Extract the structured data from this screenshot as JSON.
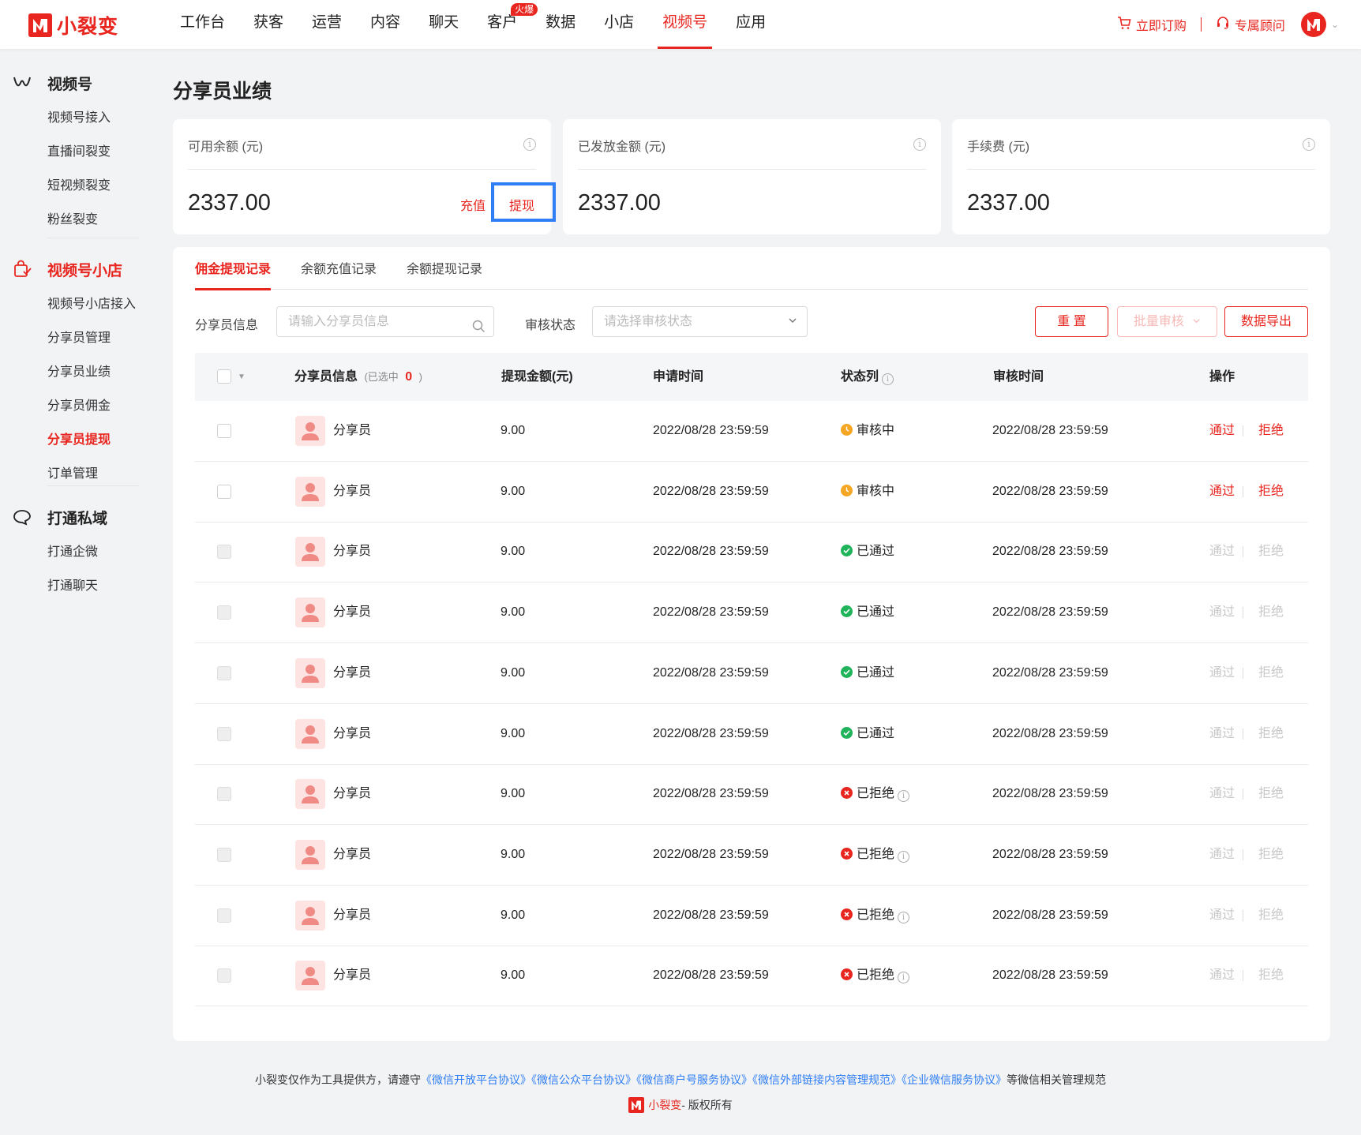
{
  "brand": {
    "name": "小裂变",
    "color": "#e8261f"
  },
  "nav": {
    "items": [
      "工作台",
      "获客",
      "运营",
      "内容",
      "聊天",
      "客户",
      "数据",
      "小店",
      "视频号",
      "应用"
    ],
    "active_index": 8,
    "hot_badge": "火爆",
    "buy_now": "立即订购",
    "advisor": "专属顾问"
  },
  "sidebar": {
    "groups": [
      {
        "title": "视频号",
        "icon": "video-channel-icon",
        "items": [
          "视频号接入",
          "直播间裂变",
          "短视频裂变",
          "粉丝裂变"
        ]
      },
      {
        "title": "视频号小店",
        "icon": "shop-bag-icon",
        "items": [
          "视频号小店接入",
          "分享员管理",
          "分享员业绩",
          "分享员佣金",
          "分享员提现",
          "订单管理"
        ]
      },
      {
        "title": "打通私域",
        "icon": "chat-bubble-icon",
        "items": [
          "打通企微",
          "打通聊天"
        ]
      }
    ],
    "active_item": "分享员提现"
  },
  "page": {
    "title": "分享员业绩"
  },
  "stats": [
    {
      "label": "可用余额 (元)",
      "value": "2337.00"
    },
    {
      "label": "已发放金额 (元)",
      "value": "2337.00"
    },
    {
      "label": "手续费 (元)",
      "value": "2337.00"
    }
  ],
  "stat_actions": {
    "recharge": "充值",
    "withdraw": "提现"
  },
  "tabs": [
    "佣金提现记录",
    "余额充值记录",
    "余额提现记录"
  ],
  "filters": {
    "sharer_label": "分享员信息",
    "sharer_placeholder": "请输入分享员信息",
    "status_label": "审核状态",
    "status_placeholder": "请选择审核状态",
    "reset": "重 置",
    "batch": "批量审核",
    "export": "数据导出"
  },
  "table": {
    "headers": {
      "sharer": "分享员信息",
      "selected_prefix": "(已选中",
      "selected_count": "0",
      "selected_suffix": ")",
      "amount": "提现金额(元)",
      "apply_time": "申请时间",
      "status": "状态列",
      "review_time": "审核时间",
      "ops": "操作"
    },
    "rows": [
      {
        "name": "分享员",
        "amount": "9.00",
        "apply_time": "2022/08/28 23:59:59",
        "status": "审核中",
        "status_type": "pending",
        "review_time": "2022/08/28 23:59:59",
        "approve": "通过",
        "reject": "拒绝"
      },
      {
        "name": "分享员",
        "amount": "9.00",
        "apply_time": "2022/08/28 23:59:59",
        "status": "审核中",
        "status_type": "pending",
        "review_time": "2022/08/28 23:59:59",
        "approve": "通过",
        "reject": "拒绝"
      },
      {
        "name": "分享员",
        "amount": "9.00",
        "apply_time": "2022/08/28 23:59:59",
        "status": "已通过",
        "status_type": "passed",
        "review_time": "2022/08/28 23:59:59",
        "approve": "通过",
        "reject": "拒绝"
      },
      {
        "name": "分享员",
        "amount": "9.00",
        "apply_time": "2022/08/28 23:59:59",
        "status": "已通过",
        "status_type": "passed",
        "review_time": "2022/08/28 23:59:59",
        "approve": "通过",
        "reject": "拒绝"
      },
      {
        "name": "分享员",
        "amount": "9.00",
        "apply_time": "2022/08/28 23:59:59",
        "status": "已通过",
        "status_type": "passed",
        "review_time": "2022/08/28 23:59:59",
        "approve": "通过",
        "reject": "拒绝"
      },
      {
        "name": "分享员",
        "amount": "9.00",
        "apply_time": "2022/08/28 23:59:59",
        "status": "已通过",
        "status_type": "passed",
        "review_time": "2022/08/28 23:59:59",
        "approve": "通过",
        "reject": "拒绝"
      },
      {
        "name": "分享员",
        "amount": "9.00",
        "apply_time": "2022/08/28 23:59:59",
        "status": "已拒绝",
        "status_type": "rejected",
        "review_time": "2022/08/28 23:59:59",
        "approve": "通过",
        "reject": "拒绝"
      },
      {
        "name": "分享员",
        "amount": "9.00",
        "apply_time": "2022/08/28 23:59:59",
        "status": "已拒绝",
        "status_type": "rejected",
        "review_time": "2022/08/28 23:59:59",
        "approve": "通过",
        "reject": "拒绝"
      },
      {
        "name": "分享员",
        "amount": "9.00",
        "apply_time": "2022/08/28 23:59:59",
        "status": "已拒绝",
        "status_type": "rejected",
        "review_time": "2022/08/28 23:59:59",
        "approve": "通过",
        "reject": "拒绝"
      },
      {
        "name": "分享员",
        "amount": "9.00",
        "apply_time": "2022/08/28 23:59:59",
        "status": "已拒绝",
        "status_type": "rejected",
        "review_time": "2022/08/28 23:59:59",
        "approve": "通过",
        "reject": "拒绝"
      }
    ]
  },
  "status_colors": {
    "pending": "#f5a623",
    "passed": "#1fb35a",
    "rejected": "#e8261f"
  },
  "footer": {
    "prefix": "小裂变仅作为工具提供方，请遵守",
    "links": [
      "《微信开放平台协议》",
      "《微信公众平台协议》",
      "《微信商户号服务协议》",
      "《微信外部链接内容管理规范》",
      "《企业微信服务协议》"
    ],
    "suffix": "等微信相关管理规范",
    "copyright_brand": "小裂变",
    "copyright_text": " - 版权所有"
  }
}
